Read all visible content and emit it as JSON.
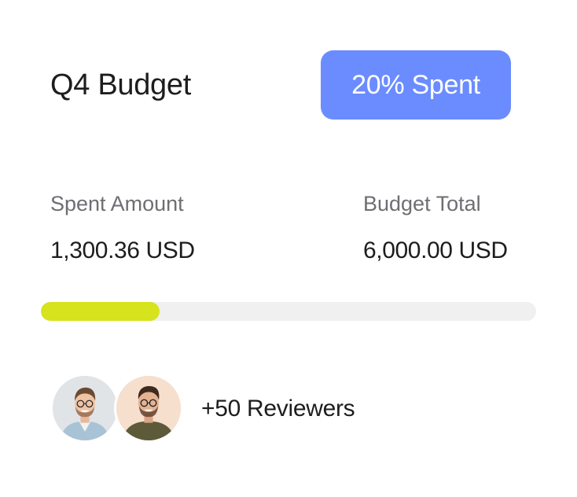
{
  "budget": {
    "title": "Q4 Budget",
    "badge_label": "20% Spent",
    "spent_label": "Spent Amount",
    "spent_value": "1,300.36 USD",
    "total_label": "Budget Total",
    "total_value": "6,000.00 USD",
    "progress_fraction": 0.24
  },
  "reviewers": {
    "label": "+50 Reviewers",
    "avatars": [
      "reviewer-avatar-1",
      "reviewer-avatar-2"
    ]
  },
  "colors": {
    "badge_bg": "#6b8cff",
    "progress_fill": "#d6e31d",
    "progress_track": "#f0f0f0",
    "text_primary": "#1d1d1f",
    "text_secondary": "#6e6e73"
  }
}
